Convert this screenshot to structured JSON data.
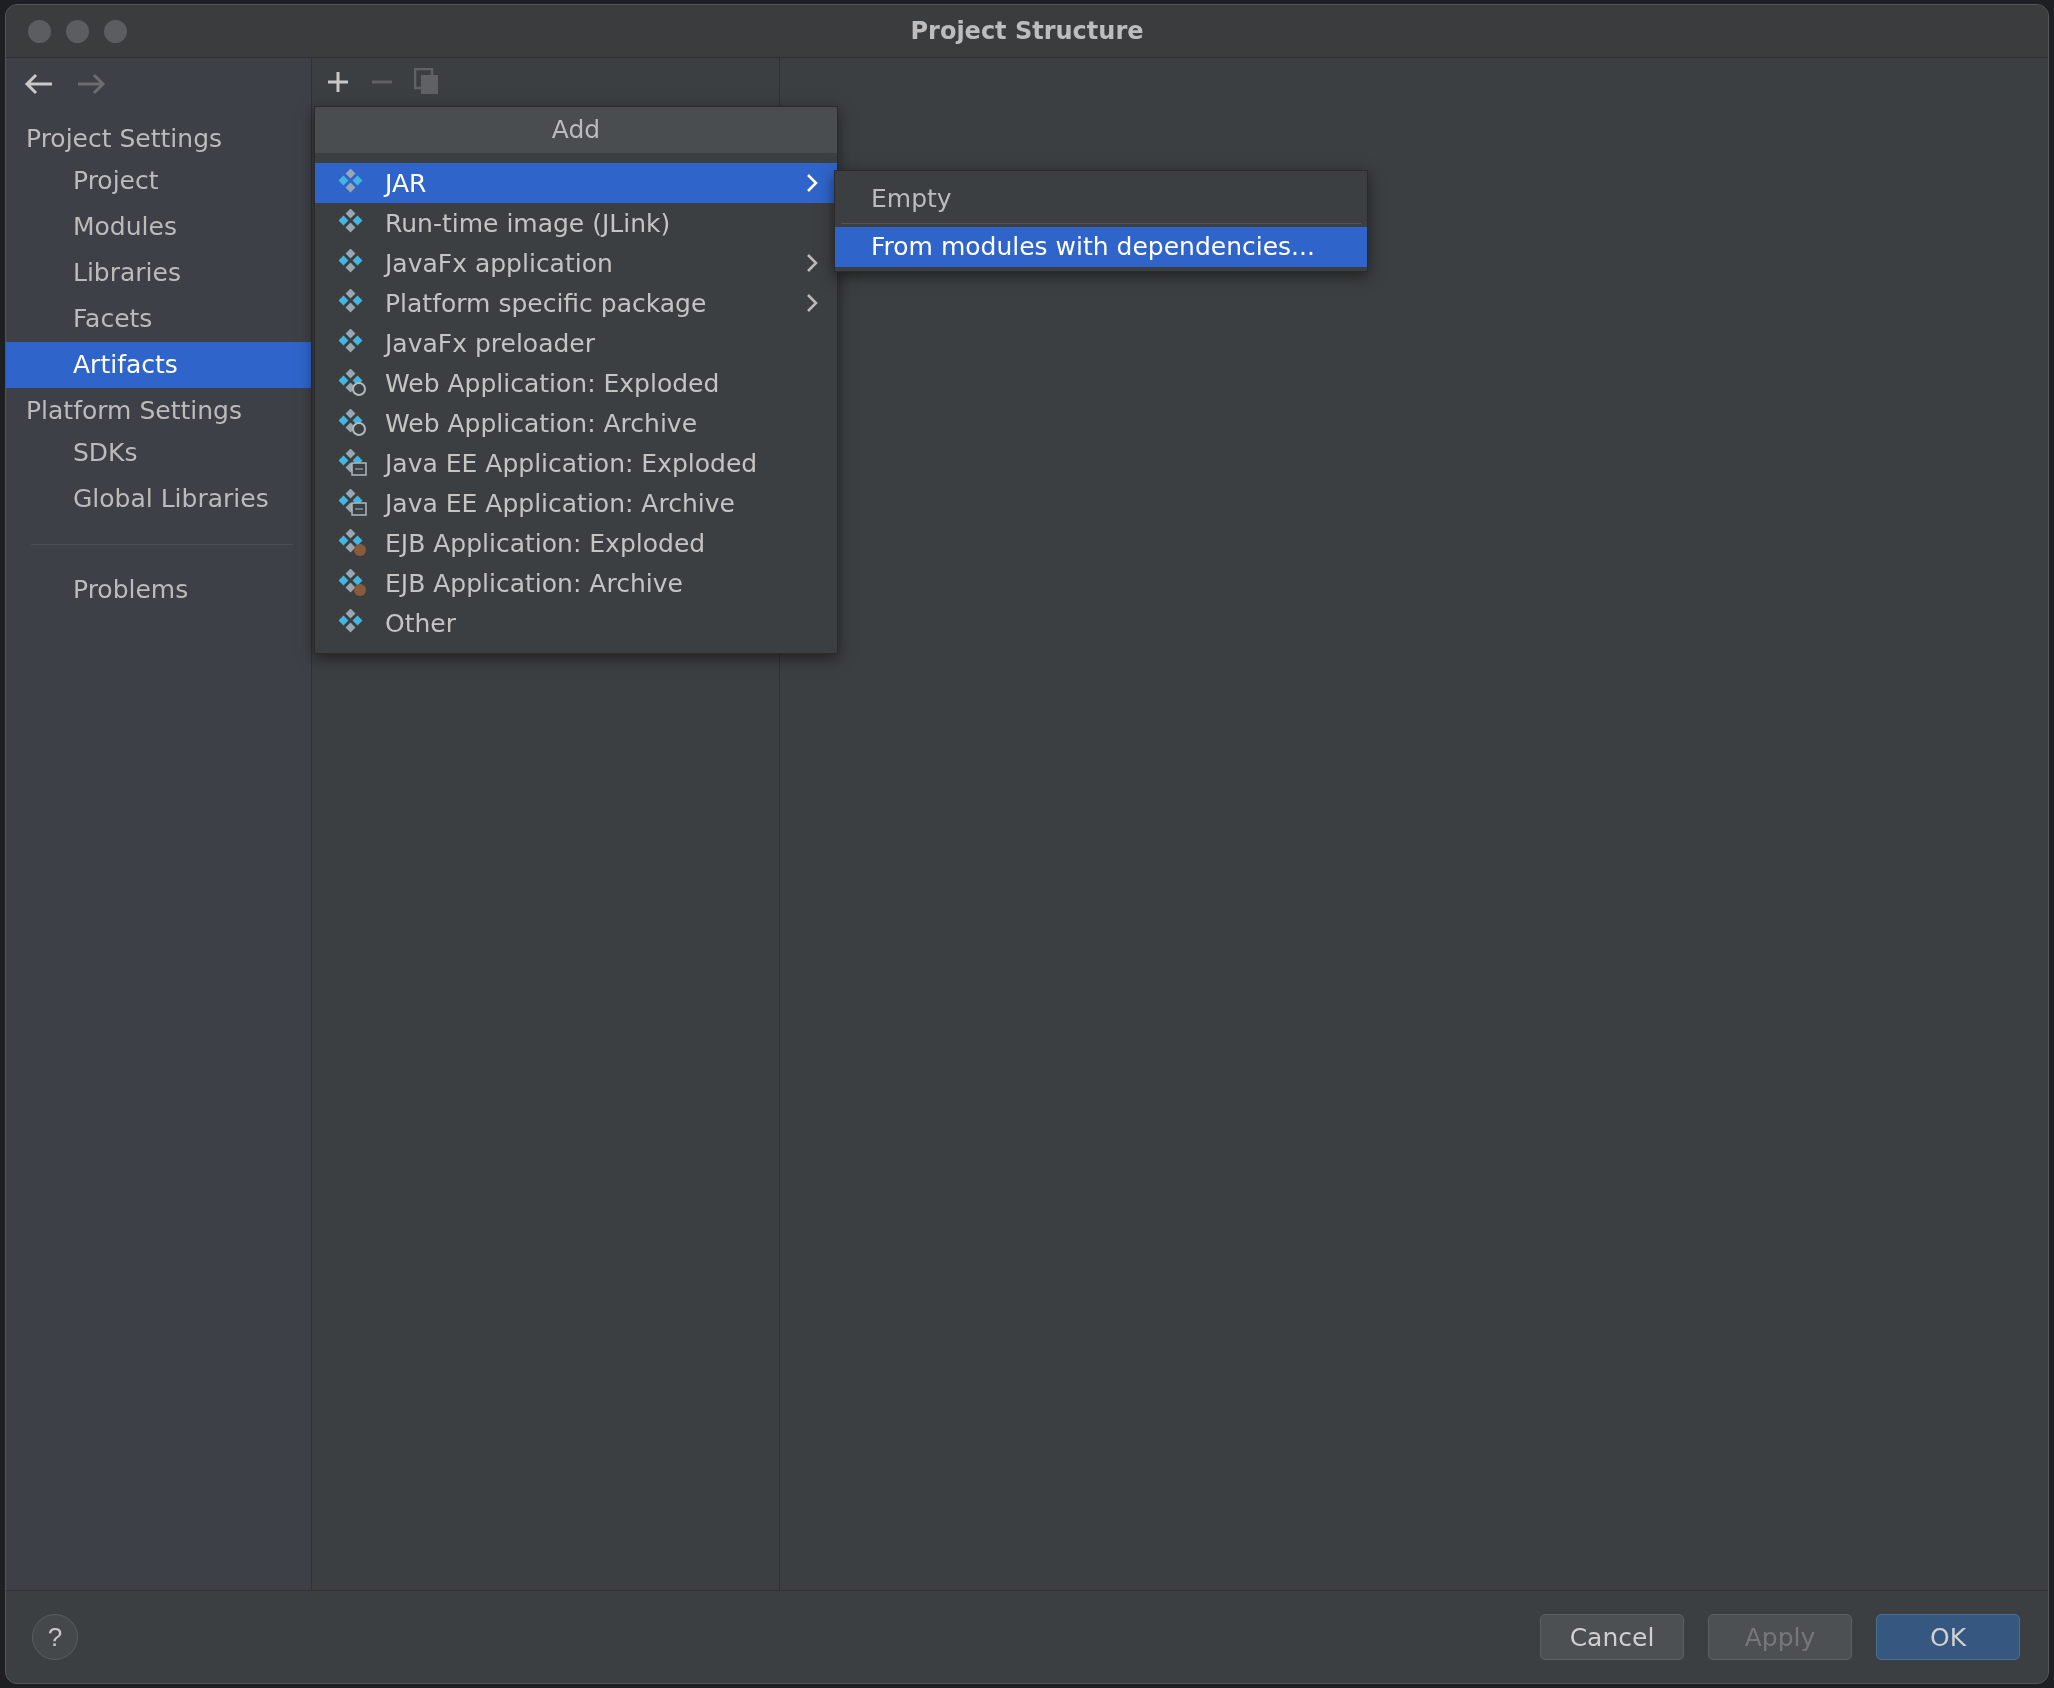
{
  "window": {
    "title": "Project Structure"
  },
  "navigation": {
    "back": {
      "disabled": false
    },
    "forward": {
      "disabled": true
    }
  },
  "sidebar": {
    "sections": [
      {
        "title": "Project Settings",
        "items": [
          {
            "label": "Project",
            "selected": false
          },
          {
            "label": "Modules",
            "selected": false
          },
          {
            "label": "Libraries",
            "selected": false
          },
          {
            "label": "Facets",
            "selected": false
          },
          {
            "label": "Artifacts",
            "selected": true
          }
        ]
      },
      {
        "title": "Platform Settings",
        "items": [
          {
            "label": "SDKs",
            "selected": false
          },
          {
            "label": "Global Libraries",
            "selected": false
          }
        ]
      }
    ],
    "footer_items": [
      {
        "label": "Problems",
        "selected": false
      }
    ]
  },
  "toolbar": {
    "add": {
      "disabled": false
    },
    "remove": {
      "disabled": true
    },
    "copy": {
      "disabled": true
    }
  },
  "add_menu": {
    "title": "Add",
    "items": [
      {
        "label": "JAR",
        "kind": "artifact",
        "submenu": true,
        "selected": true
      },
      {
        "label": "Run-time image (JLink)",
        "kind": "artifact",
        "submenu": false,
        "selected": false
      },
      {
        "label": "JavaFx application",
        "kind": "artifact",
        "submenu": true,
        "selected": false
      },
      {
        "label": "Platform specific package",
        "kind": "artifact",
        "submenu": true,
        "selected": false
      },
      {
        "label": "JavaFx preloader",
        "kind": "artifact",
        "submenu": false,
        "selected": false
      },
      {
        "label": "Web Application: Exploded",
        "kind": "web",
        "submenu": false,
        "selected": false
      },
      {
        "label": "Web Application: Archive",
        "kind": "web",
        "submenu": false,
        "selected": false
      },
      {
        "label": "Java EE Application: Exploded",
        "kind": "javaee",
        "submenu": false,
        "selected": false
      },
      {
        "label": "Java EE Application: Archive",
        "kind": "javaee",
        "submenu": false,
        "selected": false
      },
      {
        "label": "EJB Application: Exploded",
        "kind": "ejb",
        "submenu": false,
        "selected": false
      },
      {
        "label": "EJB Application: Archive",
        "kind": "ejb",
        "submenu": false,
        "selected": false
      },
      {
        "label": "Other",
        "kind": "artifact",
        "submenu": false,
        "selected": false
      }
    ]
  },
  "submenu": {
    "items": [
      {
        "label": "Empty",
        "selected": false
      },
      {
        "label": "From modules with dependencies...",
        "selected": true
      }
    ]
  },
  "help": {
    "label": "?"
  },
  "buttons": [
    {
      "label": "Cancel",
      "kind": "normal",
      "disabled": false
    },
    {
      "label": "Apply",
      "kind": "normal",
      "disabled": true
    },
    {
      "label": "OK",
      "kind": "default",
      "disabled": false
    }
  ]
}
